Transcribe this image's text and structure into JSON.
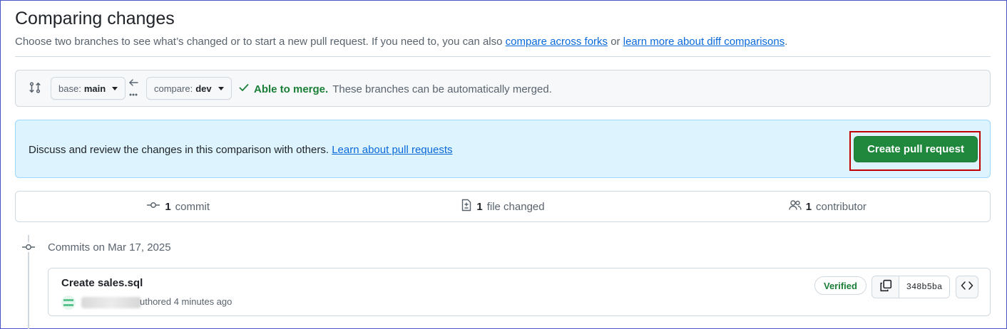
{
  "header": {
    "title": "Comparing changes",
    "subtitle_prefix": "Choose two branches to see what’s changed or to start a new pull request. If you need to, you can also ",
    "compare_forks_link": "compare across forks",
    "subtitle_or": " or ",
    "learn_diff_link": "learn more about diff comparisons",
    "subtitle_suffix": "."
  },
  "range": {
    "base_label": "base:",
    "base_value": "main",
    "compare_label": "compare:",
    "compare_value": "dev",
    "merge_status": "Able to merge.",
    "merge_message": "These branches can be automatically merged."
  },
  "pr_banner": {
    "text": "Discuss and review the changes in this comparison with others. ",
    "learn_link": "Learn about pull requests",
    "create_button": "Create pull request"
  },
  "summary": [
    {
      "icon": "git-commit-icon",
      "count": "1",
      "label": "commit"
    },
    {
      "icon": "file-diff-icon",
      "count": "1",
      "label": "file changed"
    },
    {
      "icon": "people-icon",
      "count": "1",
      "label": "contributor"
    }
  ],
  "timeline": {
    "heading": "Commits on Mar 17, 2025",
    "commit": {
      "title": "Create sales.sql",
      "authored": "uthored 4 minutes ago",
      "verified": "Verified",
      "sha": "348b5ba"
    }
  },
  "colors": {
    "accent_blue": "#0969da",
    "success_green": "#1f883d",
    "highlight_red": "#c00000",
    "banner_bg": "#ddf4ff"
  }
}
